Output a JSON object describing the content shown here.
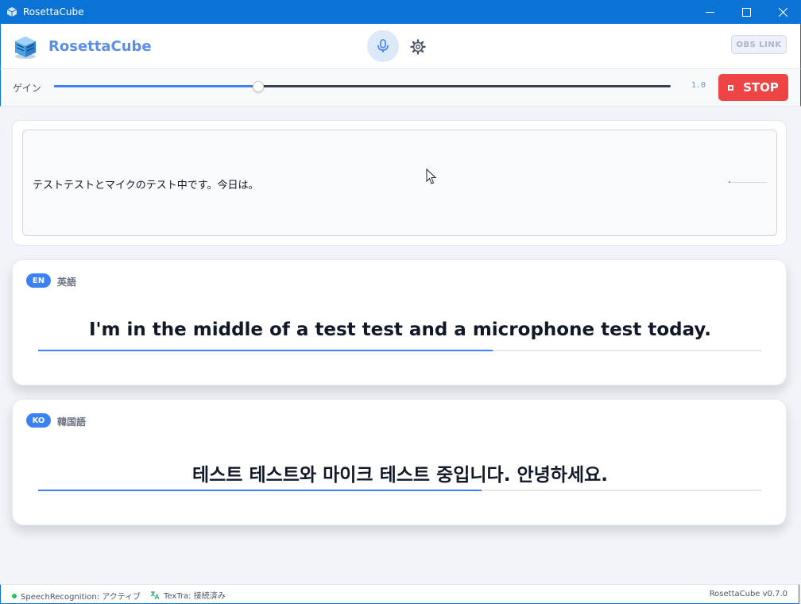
{
  "window": {
    "title": "RosettaCube"
  },
  "header": {
    "brand": "RosettaCube",
    "obs_label": "OBS LINK"
  },
  "gain": {
    "label": "ゲイン",
    "value_text": "1.0",
    "slider_fraction": 0.33,
    "stop_label": "STOP"
  },
  "recognition": {
    "text": "テストテストとマイクのテスト中です。今日は。"
  },
  "translations": [
    {
      "code": "EN",
      "language": "英語",
      "text": "I'm in the middle of a test test and a microphone test today.",
      "progress": 0.629
    },
    {
      "code": "KO",
      "language": "韓国語",
      "text": "테스트 테스트와 마이크 테스트 중입니다. 안녕하세요.",
      "progress": 0.613
    }
  ],
  "status": {
    "speech": "SpeechRecognition: アクティブ",
    "textra": "TexTra: 接続済み",
    "version": "RosettaCube v0.7.0"
  },
  "colors": {
    "accent": "#3b82f6",
    "titlebar": "#0a74d6",
    "stop": "#ef4444",
    "status_ok": "#22c55e"
  },
  "icons": [
    "app-icon",
    "minimize-icon",
    "maximize-icon",
    "close-icon",
    "logo-icon",
    "mic-icon",
    "gear-icon",
    "stop-icon",
    "translate-icon",
    "cursor-icon"
  ]
}
